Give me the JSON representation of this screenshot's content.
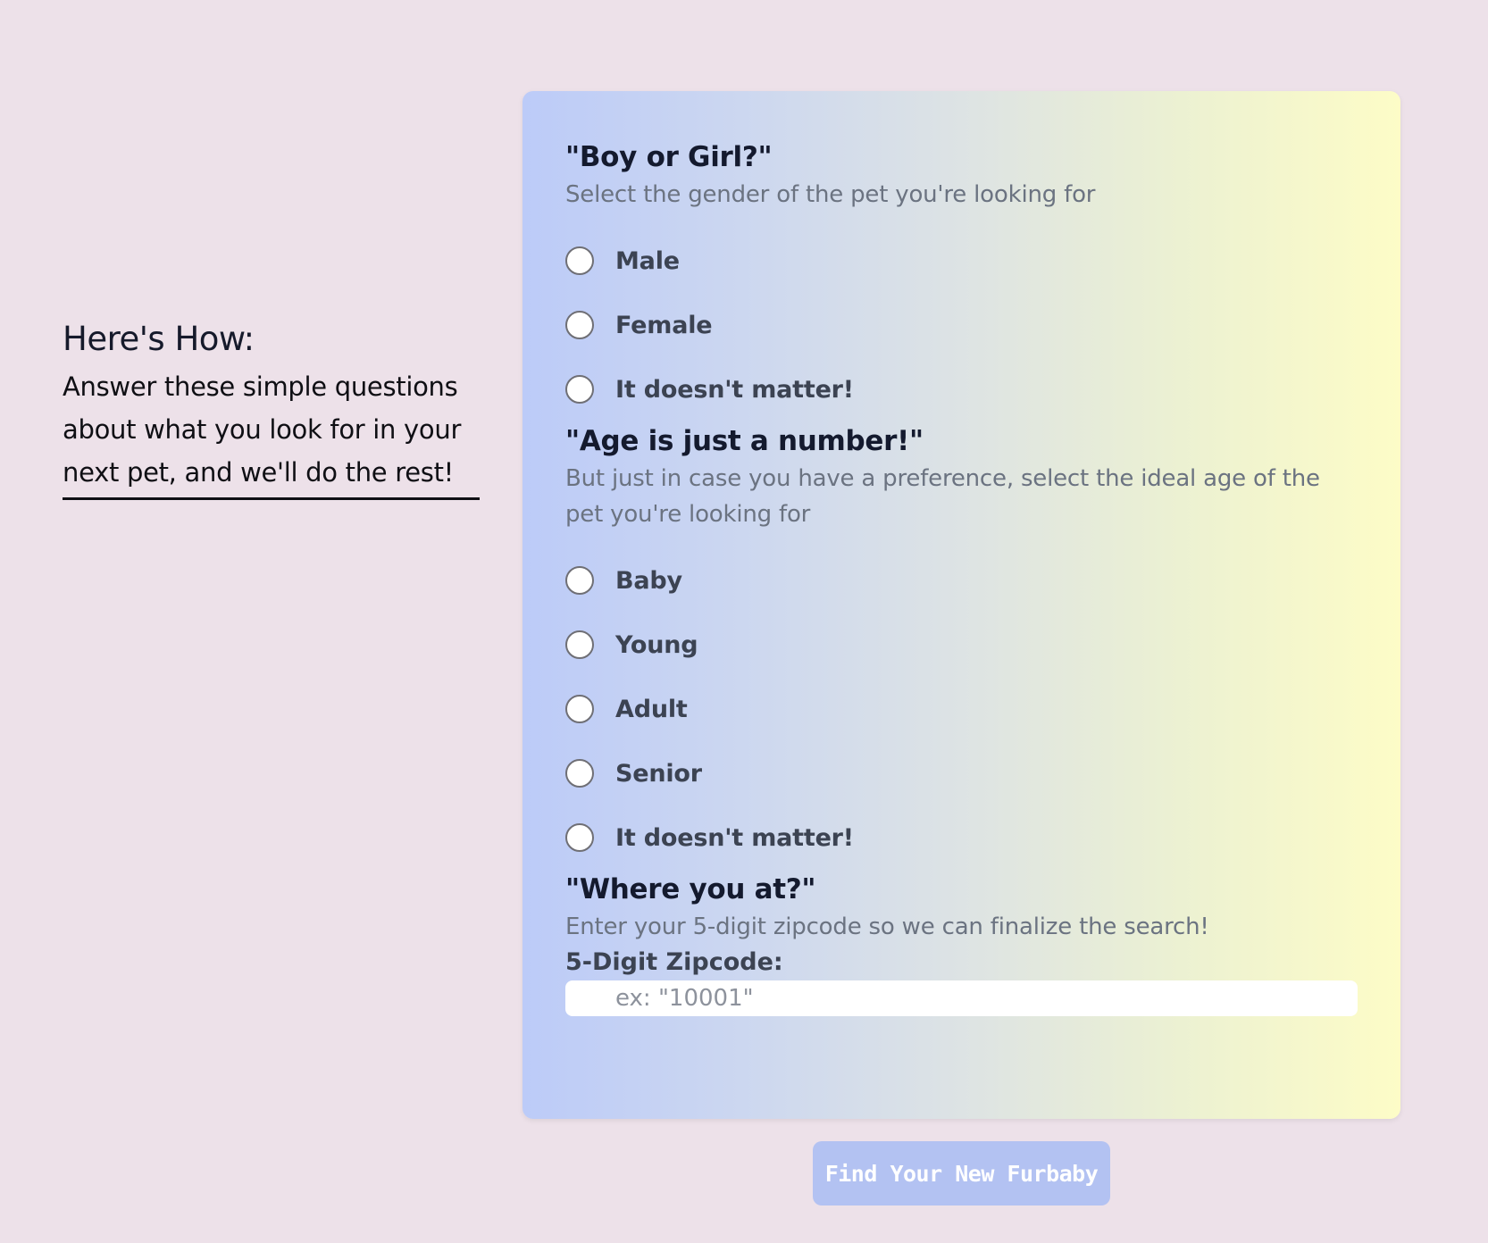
{
  "intro": {
    "heading": "Here's How:",
    "text": "Answer these simple questions about what you look for in your next pet, and we'll do the rest!"
  },
  "gender": {
    "title": "\"Boy or Girl?\"",
    "subtitle": "Select the gender of the pet you're looking for",
    "options": [
      "Male",
      "Female",
      "It doesn't matter!"
    ]
  },
  "age": {
    "title": "\"Age is just a number!\"",
    "subtitle": "But just in case you have a preference, select the ideal age of the pet you're looking for",
    "options": [
      "Baby",
      "Young",
      "Adult",
      "Senior",
      "It doesn't matter!"
    ]
  },
  "zip": {
    "title": "\"Where you at?\"",
    "subtitle": "Enter your 5-digit zipcode so we can finalize the search!",
    "label": "5-Digit Zipcode:",
    "placeholder": "ex: \"10001\"",
    "value": ""
  },
  "submit": {
    "label": "Find Your New Furbaby"
  },
  "colors": {
    "background": "#ede1e9",
    "card_gradient_start": "#bccbf8",
    "card_gradient_end": "#fdfcc7",
    "button": "#b3c2f2"
  }
}
